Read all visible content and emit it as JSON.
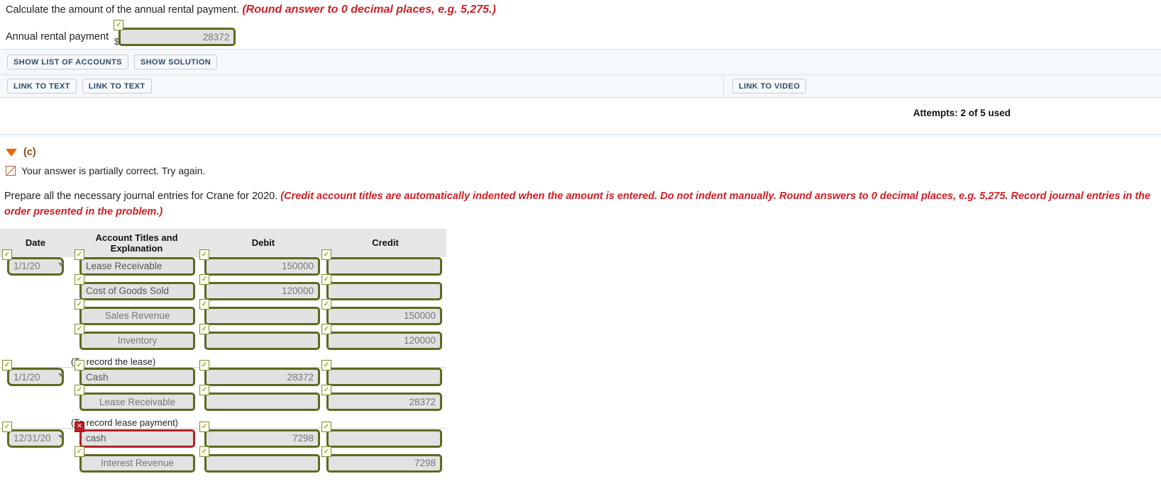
{
  "part_a": {
    "prompt": "Calculate the amount of the annual rental payment.",
    "prompt_hint": "(Round answer to 0 decimal places, e.g. 5,275.)",
    "field_label": "Annual rental payment",
    "currency_symbol": "$",
    "value": "28372",
    "check_mark": "✓"
  },
  "toolbar": {
    "show_list_of_accounts": "SHOW LIST OF ACCOUNTS",
    "show_solution": "SHOW SOLUTION",
    "link_to_text_1": "LINK TO TEXT",
    "link_to_text_2": "LINK TO TEXT",
    "link_to_video": "LINK TO VIDEO"
  },
  "attempts": "Attempts: 2 of 5 used",
  "part_c": {
    "label": "(c)",
    "status": "Your answer is partially correct.  Try again.",
    "instruction_plain_1": "Prepare all the necessary journal entries for Crane for 2020. ",
    "instruction_hint": "(Credit account titles are automatically indented when the amount is entered. Do not indent manually. Round answers to 0 decimal places, e.g. 5,275. Record journal entries in the order presented in the problem.)",
    "columns": [
      "Date",
      "Account Titles and Explanation",
      "Debit",
      "Credit"
    ],
    "check_mark": "✓",
    "x_mark": "✕",
    "groups": [
      {
        "explanation": "(To record the lease)",
        "rows": [
          {
            "date": "1/1/20",
            "date_status": "ok",
            "account": "Lease Receivable",
            "account_status": "ok",
            "indent": false,
            "debit": "150000",
            "debit_status": "ok",
            "credit": "",
            "credit_status": "ok"
          },
          {
            "date": "",
            "date_status": "none",
            "account": "Cost of Goods Sold",
            "account_status": "ok",
            "indent": false,
            "debit": "120000",
            "debit_status": "ok",
            "credit": "",
            "credit_status": "ok"
          },
          {
            "date": "",
            "date_status": "none",
            "account": "Sales Revenue",
            "account_status": "ok",
            "indent": true,
            "debit": "",
            "debit_status": "ok",
            "credit": "150000",
            "credit_status": "ok"
          },
          {
            "date": "",
            "date_status": "none",
            "account": "Inventory",
            "account_status": "ok",
            "indent": true,
            "debit": "",
            "debit_status": "ok",
            "credit": "120000",
            "credit_status": "ok"
          }
        ]
      },
      {
        "explanation": "(To record lease payment)",
        "rows": [
          {
            "date": "1/1/20",
            "date_status": "ok",
            "account": "Cash",
            "account_status": "ok",
            "indent": false,
            "debit": "28372",
            "debit_status": "ok",
            "credit": "",
            "credit_status": "ok"
          },
          {
            "date": "",
            "date_status": "none",
            "account": "Lease Receivable",
            "account_status": "ok",
            "indent": true,
            "debit": "",
            "debit_status": "ok",
            "credit": "28372",
            "credit_status": "ok"
          }
        ]
      },
      {
        "explanation": "",
        "rows": [
          {
            "date": "12/31/20",
            "date_status": "ok",
            "account": "cash",
            "account_status": "bad",
            "indent": false,
            "debit": "7298",
            "debit_status": "ok",
            "credit": "",
            "credit_status": "ok"
          },
          {
            "date": "",
            "date_status": "none",
            "account": "Interest Revenue",
            "account_status": "ok",
            "indent": true,
            "debit": "",
            "debit_status": "ok",
            "credit": "7298",
            "credit_status": "ok"
          }
        ]
      }
    ]
  }
}
